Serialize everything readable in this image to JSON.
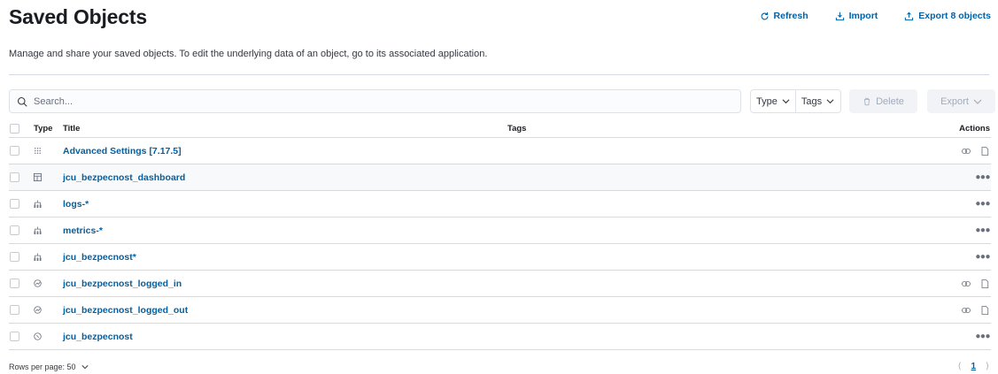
{
  "page": {
    "title": "Saved Objects",
    "subtitle": "Manage and share your saved objects. To edit the underlying data of an object, go to its associated application."
  },
  "header_actions": {
    "refresh": "Refresh",
    "import": "Import",
    "export_all": "Export 8 objects"
  },
  "toolbar": {
    "search_placeholder": "Search...",
    "type_filter": "Type",
    "tags_filter": "Tags",
    "delete": "Delete",
    "export": "Export"
  },
  "table": {
    "headers": {
      "type": "Type",
      "title": "Title",
      "tags": "Tags",
      "actions": "Actions"
    },
    "rows": [
      {
        "type_icon": "advanced-settings-icon",
        "title": "Advanced Settings [7.17.5]",
        "actions": "inspect-relationships"
      },
      {
        "type_icon": "dashboard-icon",
        "title": "jcu_bezpecnost_dashboard",
        "actions": "more"
      },
      {
        "type_icon": "index-pattern-icon",
        "title": "logs-*",
        "actions": "more"
      },
      {
        "type_icon": "index-pattern-icon",
        "title": "metrics-*",
        "actions": "more"
      },
      {
        "type_icon": "index-pattern-icon",
        "title": "jcu_bezpecnost*",
        "actions": "more"
      },
      {
        "type_icon": "visualization-icon",
        "title": "jcu_bezpecnost_logged_in",
        "actions": "inspect-relationships"
      },
      {
        "type_icon": "visualization-icon",
        "title": "jcu_bezpecnost_logged_out",
        "actions": "inspect-relationships"
      },
      {
        "type_icon": "search-icon",
        "title": "jcu_bezpecnost",
        "actions": "more"
      }
    ]
  },
  "footer": {
    "rows_per_page": "Rows per page: 50",
    "current_page": "1"
  },
  "colors": {
    "link": "#0061a6",
    "border": "#d3dae6",
    "disabled_bg": "#f1f3f6"
  }
}
